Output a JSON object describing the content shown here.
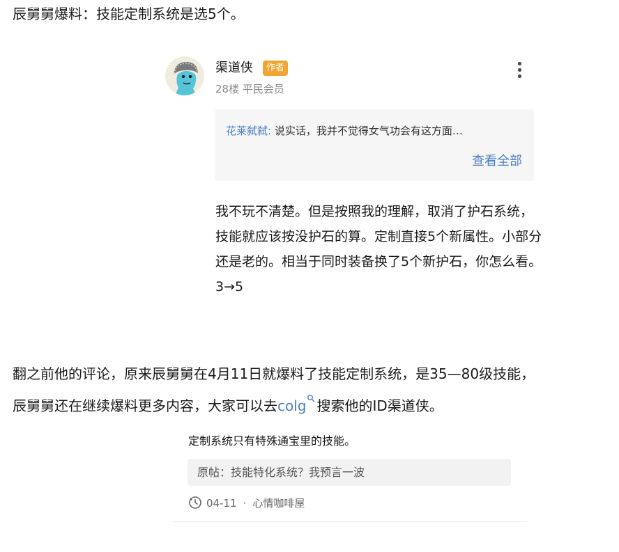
{
  "headline": "辰舅舅爆料：技能定制系统是选5个。",
  "comment": {
    "author": "渠道侠",
    "badge": "作者",
    "meta": "28楼 平民会员",
    "quote": {
      "author": "花莱弑弑:",
      "text": " 说实话，我并不觉得女气功会有这方面…",
      "view_all": "查看全部"
    },
    "body": "我不玩不清楚。但是按照我的理解，取消了护石系统，技能就应该按没护石的算。定制直接5个新属性。小部分还是老的。相当于同时装备换了5个新护石，你怎么看。 3→5"
  },
  "paragraph": {
    "line1": "翻之前他的评论，原来辰舅舅在4月11日就爆料了技能定制系统，是35—80级技能，",
    "line2_prefix": "辰舅舅还在继续爆料更多内容，大家可以去",
    "link": "colg",
    "line2_suffix": "搜索他的ID渠道侠。"
  },
  "post2": {
    "title": "定制系统只有特殊通宝里的技能。",
    "original": "原帖：技能特化系统？我预言一波",
    "date": "04-11",
    "separator": "·",
    "board": "心情咖啡屋"
  },
  "icons": {
    "menu": "more-vertical-icon",
    "search": "search-icon",
    "clock": "clock-icon",
    "avatar": "avatar-illustration"
  },
  "colors": {
    "link": "#4d7fc4",
    "badge": "#f4a531",
    "quote_bg": "#f6f6f6"
  }
}
